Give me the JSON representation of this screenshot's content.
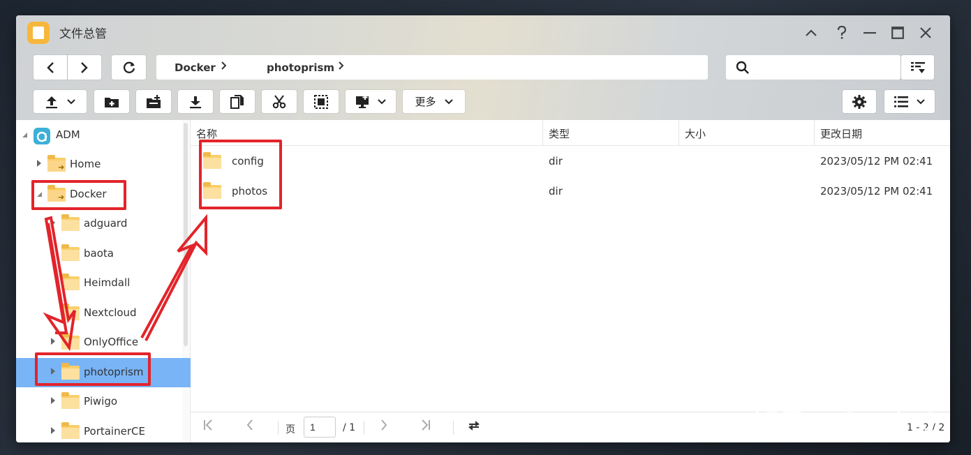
{
  "window": {
    "title": "文件总管",
    "controls": [
      "chevron-up",
      "help",
      "minimize",
      "maximize",
      "close"
    ]
  },
  "navigation": {
    "breadcrumb": [
      "Docker",
      "photoprism"
    ]
  },
  "toolbar": {
    "more_label": "更多"
  },
  "sidebar": {
    "root": "ADM",
    "items": [
      {
        "label": "Home",
        "level": 1,
        "expanded": false
      },
      {
        "label": "Docker",
        "level": 1,
        "expanded": true
      },
      {
        "label": "adguard",
        "level": 2
      },
      {
        "label": "baota",
        "level": 2
      },
      {
        "label": "Heimdall",
        "level": 2
      },
      {
        "label": "Nextcloud",
        "level": 2
      },
      {
        "label": "OnlyOffice",
        "level": 2
      },
      {
        "label": "photoprism",
        "level": 2,
        "selected": true
      },
      {
        "label": "Piwigo",
        "level": 2
      },
      {
        "label": "PortainerCE",
        "level": 2
      }
    ]
  },
  "table": {
    "columns": [
      "名称",
      "类型",
      "大小",
      "更改日期"
    ],
    "rows": [
      {
        "name": "config",
        "type": "dir",
        "size": "",
        "modified": "2023/05/12 PM 02:41"
      },
      {
        "name": "photos",
        "type": "dir",
        "size": "",
        "modified": "2023/05/12 PM 02:41"
      }
    ]
  },
  "pagination": {
    "page_label": "页",
    "current_page": "1",
    "total_pages": "/ 1",
    "range": "1 - 2 / 2"
  },
  "watermark": "知乎 @Stark-C",
  "colors": {
    "selected_row": "#79b4f6",
    "annotation": "#e2242b",
    "folder": "#f9cf6a",
    "app_icon": "#f6b73c"
  }
}
